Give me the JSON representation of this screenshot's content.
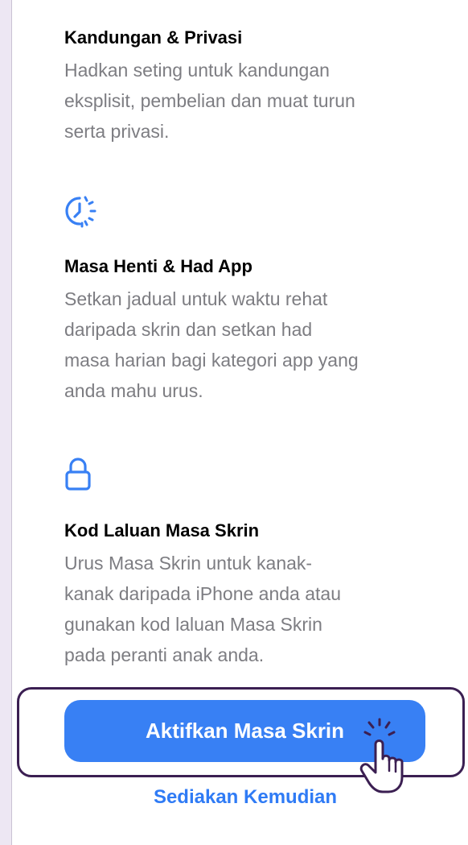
{
  "sections": [
    {
      "title": "Kandungan & Privasi",
      "description": [
        "Hadkan seting untuk kandungan",
        "eksplisit, pembelian dan muat turun",
        "serta privasi."
      ]
    },
    {
      "icon": "downtime-icon",
      "title": "Masa Henti & Had App",
      "description": [
        "Setkan jadual untuk waktu rehat",
        "daripada skrin dan setkan had",
        "masa harian bagi kategori app yang",
        "anda mahu urus."
      ]
    },
    {
      "icon": "lock-icon",
      "title": "Kod Laluan Masa Skrin",
      "description": [
        "Urus Masa Skrin untuk kanak-",
        "kanak daripada iPhone anda atau",
        "gunakan kod laluan Masa Skrin",
        "pada peranti anak anda."
      ]
    }
  ],
  "primary_button": {
    "label": "Aktifkan Masa Skrin"
  },
  "secondary_button": {
    "label": "Sediakan Kemudian"
  },
  "colors": {
    "accent": "#3880f4",
    "link": "#2f7bf5",
    "highlight_border": "#3b1f52",
    "description_text": "#7d7d82"
  }
}
